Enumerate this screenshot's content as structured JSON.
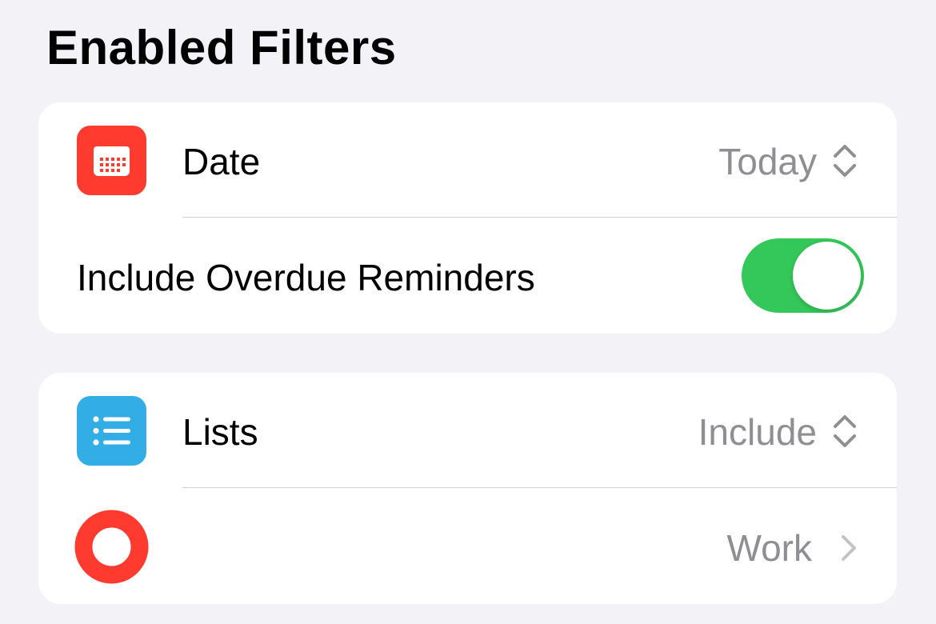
{
  "section": {
    "title": "Enabled Filters"
  },
  "date_filter": {
    "label": "Date",
    "value": "Today",
    "icon": "calendar-icon",
    "icon_color": "#ff3b30"
  },
  "overdue": {
    "label": "Include Overdue Reminders",
    "toggle_on": true,
    "toggle_color": "#34c759"
  },
  "lists_filter": {
    "label": "Lists",
    "value": "Include",
    "icon": "list-bullet-icon",
    "icon_color": "#32ade6"
  },
  "list_item": {
    "value": "Work",
    "icon": "list-color-circle-icon",
    "icon_color": "#ff3b30"
  },
  "colors": {
    "background": "#f2f2f7",
    "card": "#ffffff",
    "secondary_text": "#8e8e93",
    "separator": "#cfcfd4"
  }
}
